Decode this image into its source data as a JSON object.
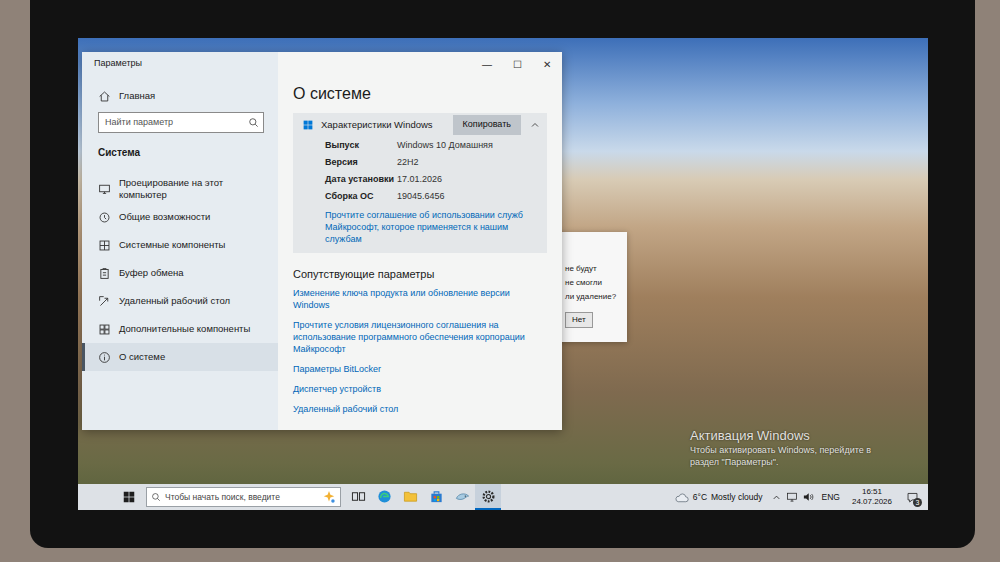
{
  "settings": {
    "title": "Параметры",
    "controls": [
      "—",
      "☐",
      "✕"
    ],
    "home": "Главная",
    "search": {
      "placeholder": "Найти параметр"
    },
    "section": "Система",
    "sidebar": {
      "items": [
        {
          "label": "Проецирование на этот компьютер",
          "selected": false
        },
        {
          "label": "Общие возможности",
          "selected": false
        },
        {
          "label": "Системные компоненты",
          "selected": false
        },
        {
          "label": "Буфер обмена",
          "selected": false
        },
        {
          "label": "Удаленный рабочий стол",
          "selected": false
        },
        {
          "label": "Дополнительные компоненты",
          "selected": false
        },
        {
          "label": "О системе",
          "selected": true
        }
      ]
    },
    "page": {
      "title": "О системе",
      "spec": {
        "title": "Характеристики Windows",
        "copy_button": "Копировать",
        "expanded": true,
        "rows": [
          {
            "label": "Выпуск",
            "value": "Windows 10 Домашняя"
          },
          {
            "label": "Версия",
            "value": "22H2"
          },
          {
            "label": "Дата установки",
            "value": "17.01.2026"
          },
          {
            "label": "Сборка ОС",
            "value": "19045.6456"
          }
        ],
        "link": "Прочтите соглашение об использовании служб Майкрософт, которое применяется к нашим службам"
      },
      "related": {
        "title": "Сопутствующие параметры",
        "links": [
          "Изменение ключа продукта или обновление версии Windows",
          "Прочтите условия лицензионного соглашения на использование программного обеспечения корпорации Майкрософт",
          "Параметры BitLocker",
          "Диспетчер устройств",
          "Удаленный рабочий стол"
        ]
      }
    }
  },
  "dialog": {
    "lines": [
      "не будут",
      "не смогли",
      "ли удаление?"
    ],
    "button": "Нет"
  },
  "watermark": {
    "title": "Активация Windows",
    "lines": [
      "Чтобы активировать Windows, перейдите в",
      "раздел \"Параметры\"."
    ]
  },
  "taskbar": {
    "search": {
      "placeholder": "Чтобы начать поиск, введите"
    },
    "apps": [
      {
        "active": false
      },
      {
        "active": false
      },
      {
        "active": false
      },
      {
        "active": false
      },
      {
        "active": false
      },
      {
        "active": true
      }
    ],
    "weather": {
      "temperature": "6°C",
      "condition": "Mostly cloudy"
    },
    "language": "ENG",
    "time": "16:51",
    "date": "24.07.2026",
    "notifications": "3"
  }
}
